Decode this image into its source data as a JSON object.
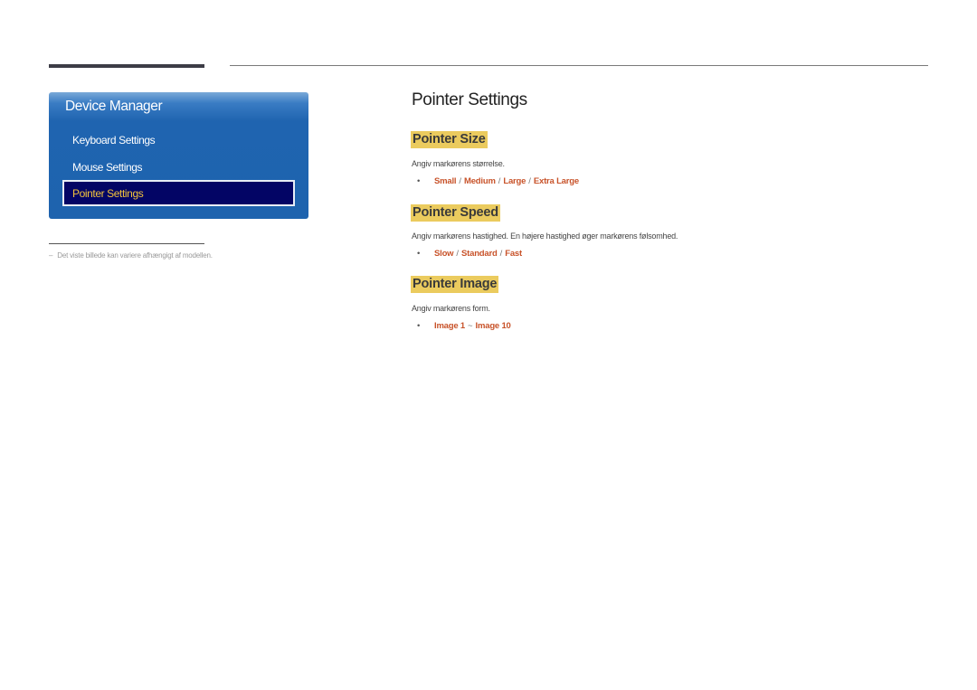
{
  "sidebar": {
    "title": "Device Manager",
    "items": [
      {
        "label": "Keyboard Settings",
        "selected": false
      },
      {
        "label": "Mouse Settings",
        "selected": false
      },
      {
        "label": "Pointer Settings",
        "selected": true
      }
    ]
  },
  "footnote": {
    "dash": "‒",
    "text": "Det viste billede kan variere afhængigt af modellen."
  },
  "main": {
    "title": "Pointer Settings",
    "sections": [
      {
        "heading": "Pointer Size",
        "description": "Angiv markørens størrelse.",
        "options": [
          "Small",
          "Medium",
          "Large",
          "Extra Large"
        ],
        "separator": "/"
      },
      {
        "heading": "Pointer Speed",
        "description": "Angiv markørens hastighed. En højere hastighed øger markørens følsomhed.",
        "options": [
          "Slow",
          "Standard",
          "Fast"
        ],
        "separator": "/"
      },
      {
        "heading": "Pointer Image",
        "description": "Angiv markørens form.",
        "options": [
          "Image 1",
          "Image 10"
        ],
        "separator": "~"
      }
    ],
    "bullet": "•"
  },
  "colors": {
    "panel_blue": "#1f64b0",
    "selected_bg": "#030565",
    "selected_text": "#f2c33c",
    "heading_highlight": "#ebcb5e",
    "option_orange": "#c8532a"
  }
}
